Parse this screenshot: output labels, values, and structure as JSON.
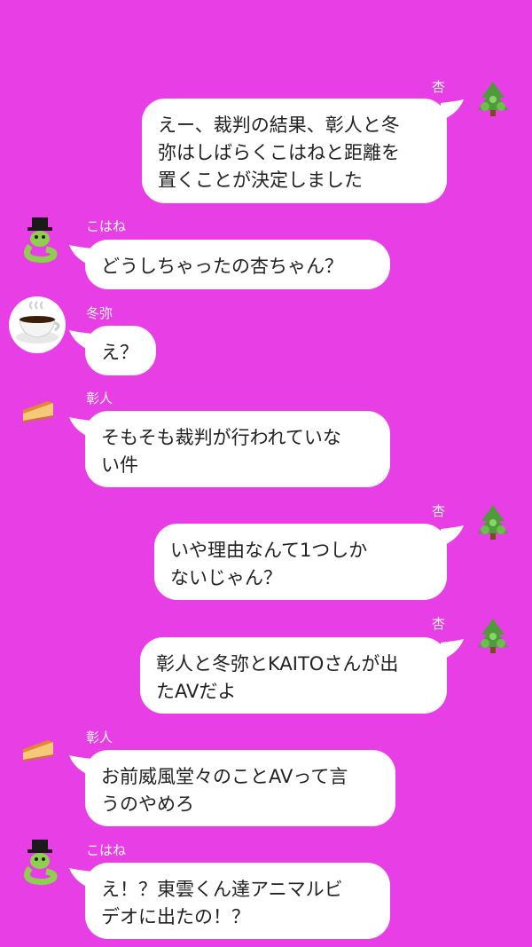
{
  "chat": {
    "messages": [
      {
        "sender": "杏",
        "side": "right",
        "avatar": "tree-icon",
        "text": "えー、裁判の結果、彰人と冬\n弥はしばらくこはねと距離を\n置くことが決定しました"
      },
      {
        "sender": "こはね",
        "side": "left",
        "avatar": "snake-hat-icon",
        "text": "どうしちゃったの杏ちゃん？"
      },
      {
        "sender": "冬弥",
        "side": "left",
        "avatar": "coffee-cup-icon",
        "text": "え？"
      },
      {
        "sender": "彰人",
        "side": "left",
        "avatar": "cheesecake-icon",
        "text": "そもそも裁判が行われていな\nい件"
      },
      {
        "sender": "杏",
        "side": "right",
        "avatar": "tree-icon",
        "text": "いや理由なんて1つしか\nないじゃん？"
      },
      {
        "sender": "杏",
        "side": "right",
        "avatar": "tree-icon",
        "text": "彰人と冬弥とKAITOさんが出\nたAVだよ"
      },
      {
        "sender": "彰人",
        "side": "left",
        "avatar": "cheesecake-icon",
        "text": "お前威風堂々のことAVって言\nうのやめろ"
      },
      {
        "sender": "こはね",
        "side": "left",
        "avatar": "snake-hat-icon",
        "text": "え！？東雲くん達アニマルビ\nデオに出たの！？"
      }
    ]
  },
  "colors": {
    "background": "#e83ee6",
    "bubble": "#ffffff",
    "text": "#222222",
    "name": "#ffffff"
  }
}
